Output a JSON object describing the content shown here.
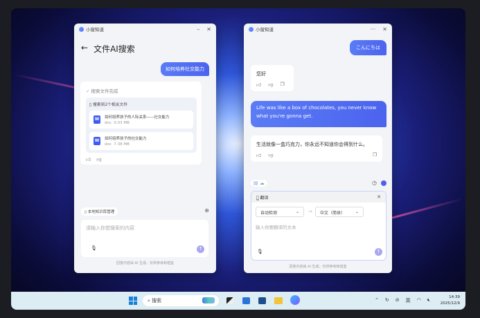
{
  "left_window": {
    "app_title": "小窗知道",
    "page_title": "文件AI搜索",
    "user_query": "如何培养社交能力",
    "status": "搜索文件完成",
    "found_label": "搜索到2个相关文件",
    "files": [
      {
        "name": "如何培养孩子的人际关系——社交能力",
        "type": "doc",
        "size": "0.03 MB"
      },
      {
        "name": "如何培养孩子的社交能力",
        "type": "doc",
        "size": "7.38 MB"
      }
    ],
    "kb_button": "本地知识库管理",
    "input_placeholder": "请输入你想搜索的内容",
    "disclaimer": "回答内容由 AI 生成，仅供参考和借鉴"
  },
  "right_window": {
    "app_title": "小窗知道",
    "messages": [
      {
        "role": "user",
        "text": "こんにちは"
      },
      {
        "role": "assistant",
        "text": "您好"
      },
      {
        "role": "user",
        "text": "Life was like a box of chocolates, you never know what you're gonna get."
      },
      {
        "role": "assistant",
        "text": "生活就像一盒巧克力，你永远不知道你会得到什么。"
      }
    ],
    "translate_title": "翻译",
    "source_lang": "自动检测",
    "target_lang": "中文（简体）",
    "input_placeholder": "输入你要翻译的文本",
    "disclaimer": "回答内容由 AI 生成，仅供参考和借鉴"
  },
  "taskbar": {
    "search_placeholder": "搜索",
    "ime": "英",
    "time": "14:39",
    "date": "2025/12/9"
  },
  "colors": {
    "accent": "#4c63ee",
    "taskbar": "#dcedf3"
  }
}
